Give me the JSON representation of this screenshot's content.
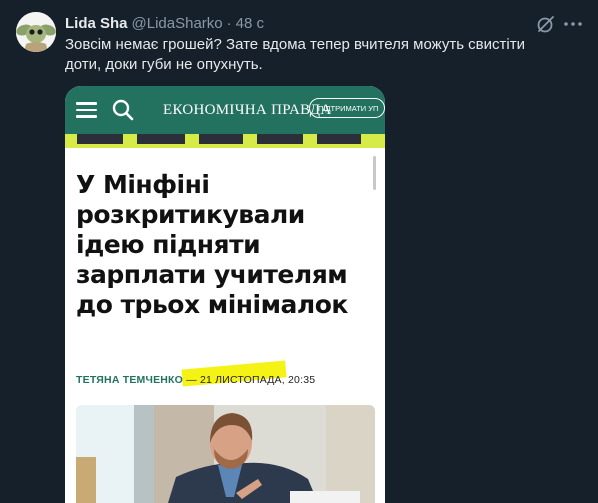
{
  "tweet": {
    "display_name": "Lida Sha",
    "handle": "@LidaSharko",
    "separator": "·",
    "time": "48 с",
    "text": "Зовсім немає грошей? Зате вдома тепер вчителя можуть свистіти доти, доки губи не опухнуть."
  },
  "media": {
    "site_logo": "ЕКОНОМІЧНА ПРАВДА",
    "support_button": "ПІДТРИМАТИ УП",
    "headline": "У Мінфіні розкритикували ідею підняти зарплати учителям до трьох мінімалок",
    "byline": {
      "author": "ТЕТЯНА ТЕМЧЕНКО",
      "dash": " — ",
      "date": "21 ЛИСТОПАДА, 20:35"
    }
  },
  "colors": {
    "background": "#15202b",
    "brand_green": "#22725f",
    "highlight_yellow": "#f4f10a",
    "strip_yellow": "#d6eb47"
  }
}
